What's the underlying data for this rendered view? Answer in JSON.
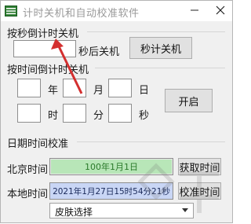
{
  "window": {
    "title": "计时关机和自动校准软件"
  },
  "section_countdown": {
    "heading": "按秒倒计时关机",
    "seconds_value": "",
    "after_label": "秒后关机",
    "button_label": "秒计关机"
  },
  "section_timed": {
    "heading": "按时间倒计时关机",
    "year_value": "",
    "year_label": "年",
    "month_value": "",
    "month_label": "月",
    "day_value": "",
    "day_label": "日",
    "hour_value": "",
    "hour_label": "时",
    "minute_value": "",
    "minute_label": "分",
    "second_value": "",
    "second_label": "秒",
    "start_button_label": "开启"
  },
  "section_calibrate": {
    "heading": "日期时间校准",
    "beijing_label": "北京时间",
    "beijing_value": "100年1月1日",
    "beijing_value_color": "#2a7a2a",
    "fetch_button_label": "获取时间",
    "local_label": "本地时间",
    "local_value": "2021年1月27日15时54分21秒",
    "calibrate_button_label": "校准时间"
  },
  "skin": {
    "selected": "皮肤选择"
  },
  "colors": {
    "arrow": "#d32f2f",
    "progress_green": "#b8e6b8",
    "local_bar": "#c9d6f5"
  }
}
